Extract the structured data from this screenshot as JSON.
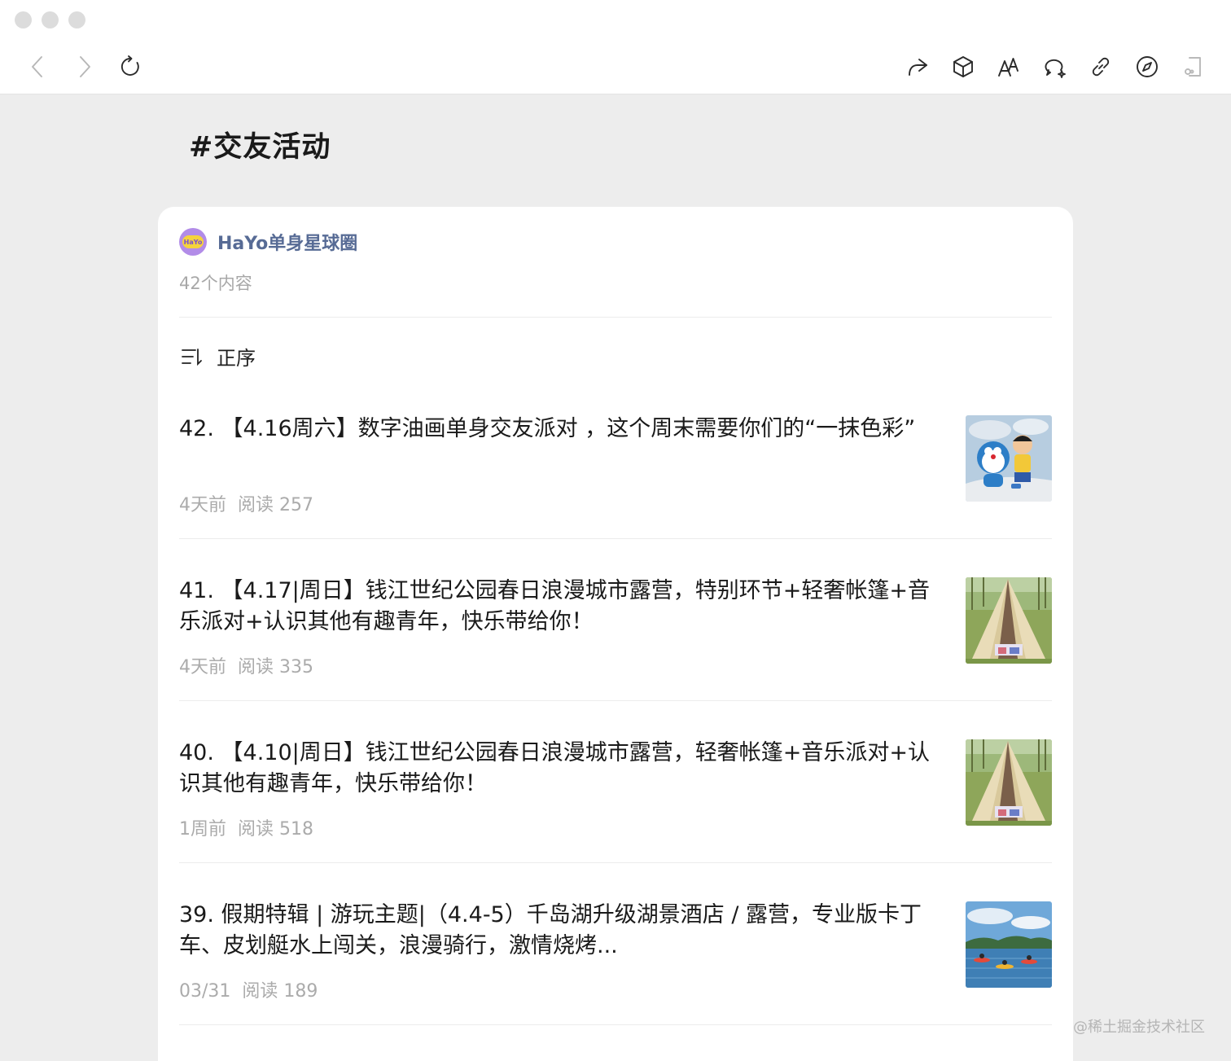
{
  "toolbar": {
    "icons": [
      "back-icon",
      "forward-icon",
      "refresh-icon",
      "share-icon",
      "box-icon",
      "font-size-icon",
      "comment-icon",
      "link-icon",
      "compass-icon",
      "reading-mode-icon"
    ]
  },
  "page": {
    "title": "#交友活动"
  },
  "circle": {
    "avatar_text": "HaYo",
    "name": "HaYo单身星球圈",
    "count": "42个内容"
  },
  "sort": {
    "label": "正序"
  },
  "articles": [
    {
      "title": "42. 【4.16周六】数字油画单身交友派对 ，这个周末需要你们的“一抹色彩”",
      "time": "4天前",
      "reads": "阅读 257",
      "thumb": "cartoon"
    },
    {
      "title": "41. 【4.17|周日】钱江世纪公园春日浪漫城市露营，特别环节+轻奢帐篷+音乐派对+认识其他有趣青年，快乐带给你！",
      "time": "4天前",
      "reads": "阅读 335",
      "thumb": "tent"
    },
    {
      "title": "40. 【4.10|周日】钱江世纪公园春日浪漫城市露营，轻奢帐篷+音乐派对+认识其他有趣青年，快乐带给你！",
      "time": "1周前",
      "reads": "阅读 518",
      "thumb": "tent"
    },
    {
      "title": "39. 假期特辑 | 游玩主题|（4.4-5）千岛湖升级湖景酒店 / 露营，专业版卡丁车、皮划艇水上闯关，浪漫骑行，激情烧烤...",
      "time": "03/31",
      "reads": "阅读 189",
      "thumb": "lake"
    }
  ],
  "watermark": "@稀土掘金技术社区",
  "colors": {
    "link_blue": "#576b95",
    "meta_gray": "#ababab",
    "background": "#ededed"
  }
}
